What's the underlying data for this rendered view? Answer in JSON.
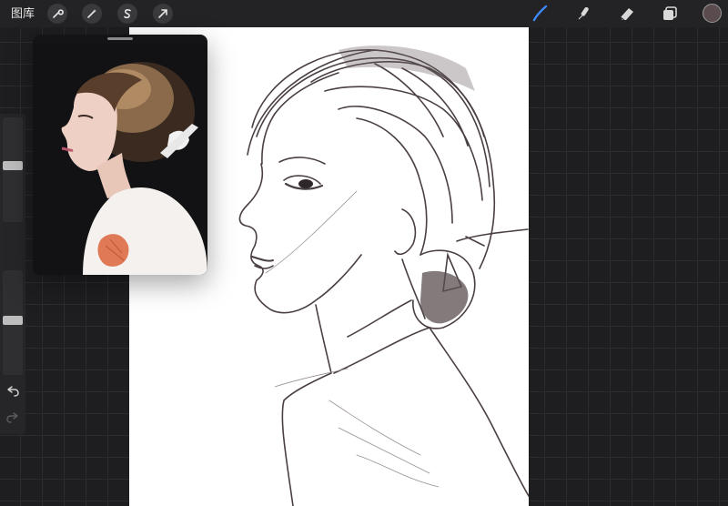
{
  "toolbar": {
    "gallery_label": "图库",
    "left_tools": [
      {
        "name": "actions",
        "icon": "wrench-icon"
      },
      {
        "name": "adjustments",
        "icon": "magic-wand-icon"
      },
      {
        "name": "selection",
        "icon": "selection-s-icon"
      },
      {
        "name": "transform",
        "icon": "arrow-cursor-icon"
      }
    ],
    "right_tools": [
      {
        "name": "brush",
        "icon": "brush-icon",
        "active": true,
        "color": "#3d8bff"
      },
      {
        "name": "smudge",
        "icon": "smudge-icon"
      },
      {
        "name": "eraser",
        "icon": "eraser-icon"
      },
      {
        "name": "layers",
        "icon": "layers-icon"
      }
    ],
    "current_color": "#5a4b4e"
  },
  "sidebar": {
    "brush_size_level": 0.65,
    "opacity_level": 0.5,
    "undo_icon": "undo-icon",
    "redo_icon": "redo-icon",
    "modifier_icon": "square-modifier-icon"
  },
  "reference": {
    "image_description_icon": "reference-photo"
  }
}
